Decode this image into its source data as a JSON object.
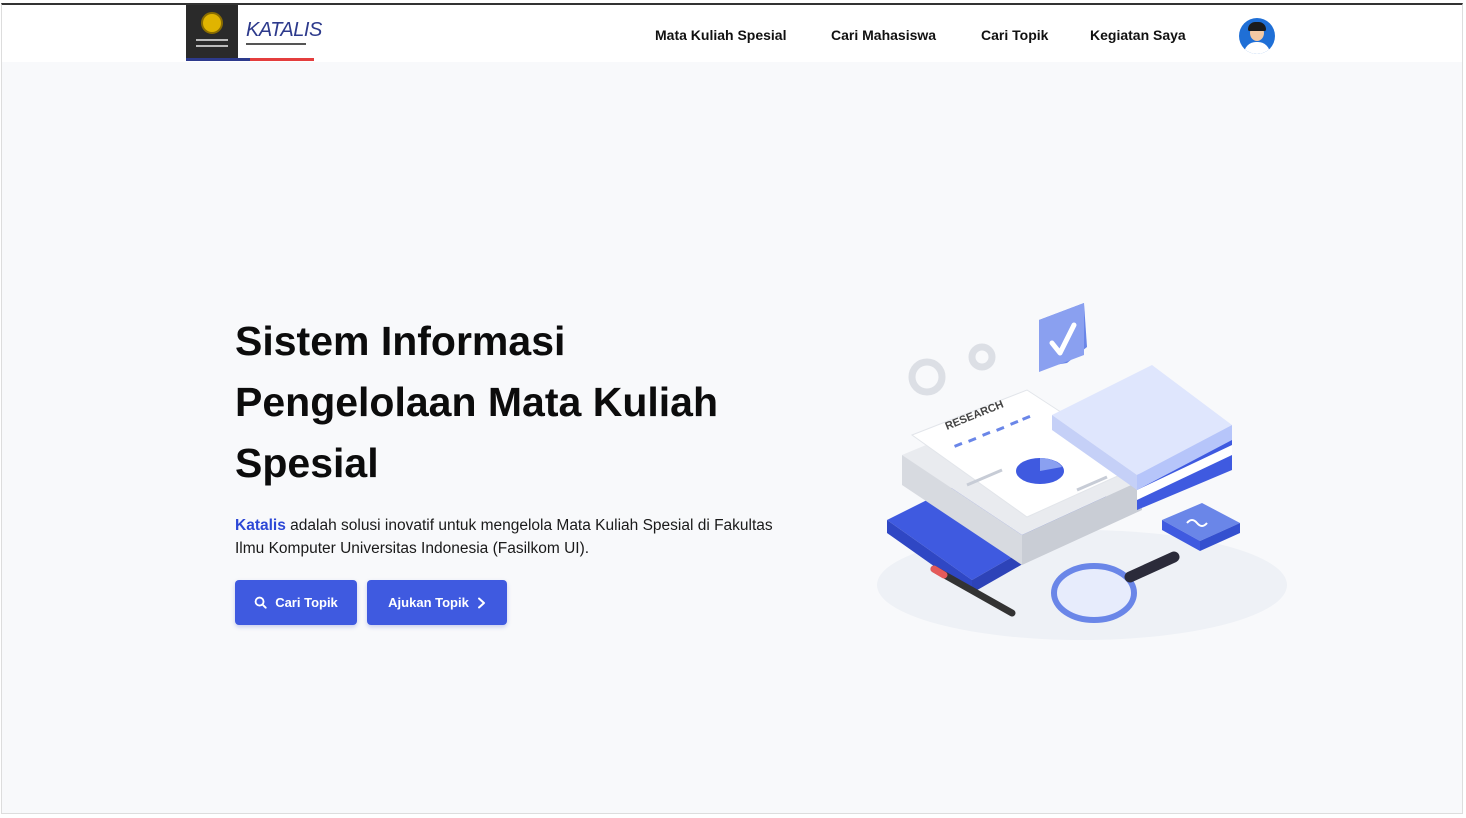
{
  "brand": {
    "name": "KATALIS"
  },
  "nav": {
    "items": [
      {
        "label": "Mata Kuliah Spesial"
      },
      {
        "label": "Cari Mahasiswa"
      },
      {
        "label": "Cari Topik"
      },
      {
        "label": "Kegiatan Saya"
      }
    ]
  },
  "hero": {
    "title_lines": [
      "Sistem Informasi",
      "Pengelolaan Mata Kuliah",
      "Spesial"
    ],
    "desc_brand": "Katalis",
    "desc_rest": " adalah solusi inovatif untuk mengelola Mata Kuliah Spesial di Fakultas Ilmu Komputer Universitas Indonesia (Fasilkom UI).",
    "btn_search": "Cari Topik",
    "btn_submit": "Ajukan Topik"
  },
  "illustration": {
    "doc_label": "RESEARCH"
  },
  "colors": {
    "accent": "#3f5ae0",
    "brand_text": "#2d48d6",
    "background": "#f8f9fb"
  },
  "icons": {
    "search": "search-icon",
    "chevron": "chevron-right-icon",
    "avatar": "user-avatar"
  }
}
